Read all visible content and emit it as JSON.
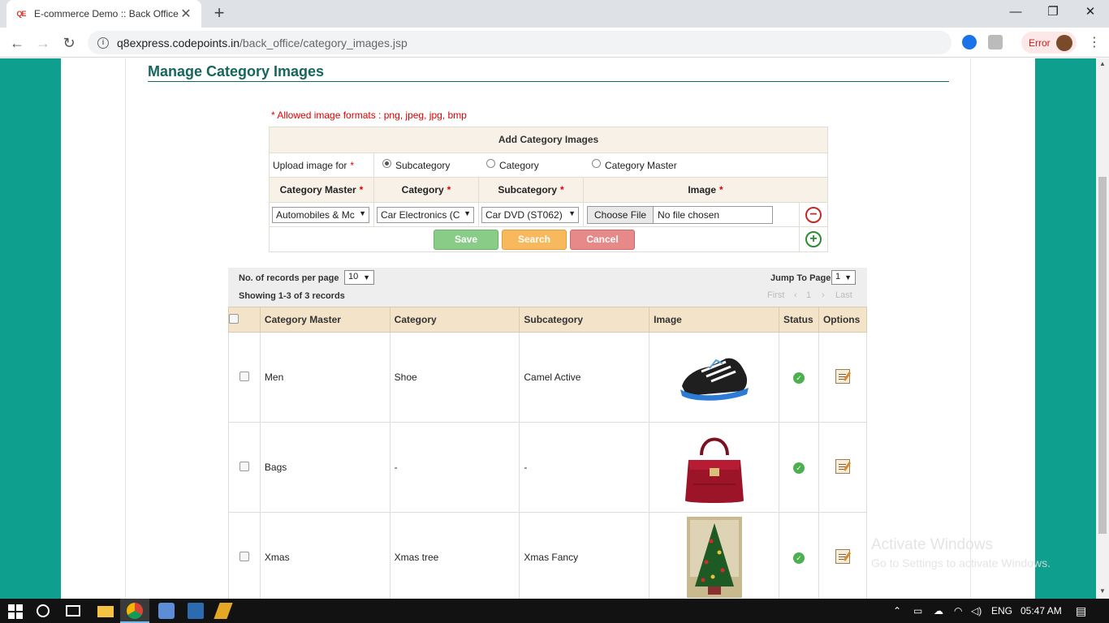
{
  "browser": {
    "tab_favicon": "QE",
    "tab_title": "E-commerce Demo :: Back Office",
    "tab_close": "✕",
    "new_tab": "+",
    "url_host": "q8express.codepoints.in",
    "url_path": "/back_office/category_images.jsp",
    "error_label": "Error",
    "window_minimize": "—",
    "window_restore": "❐",
    "window_close": "✕"
  },
  "page": {
    "title": "Manage Category Images",
    "allowed_formats_note": "* Allowed image formats : png, jpeg, jpg, bmp"
  },
  "add_form": {
    "heading": "Add Category Images",
    "upload_for_label": "Upload image for",
    "required_mark": "*",
    "radio_options": [
      {
        "label": "Subcategory",
        "checked": true
      },
      {
        "label": "Category",
        "checked": false
      },
      {
        "label": "Category Master",
        "checked": false
      }
    ],
    "columns": [
      "Category Master",
      "Category",
      "Subcategory",
      "Image"
    ],
    "category_master_value": "Automobiles & Mc",
    "category_value": "Car Electronics (C",
    "subcategory_value": "Car DVD (ST062)",
    "file_button": "Choose File",
    "file_status": "No file chosen",
    "buttons": {
      "save": "Save",
      "search": "Search",
      "cancel": "Cancel"
    }
  },
  "listing": {
    "records_per_page_label": "No. of records per page",
    "records_per_page_value": "10",
    "showing_text": "Showing 1-3 of 3 records",
    "jump_to_page_label": "Jump To Page",
    "jump_to_page_value": "1",
    "pager": {
      "first": "First",
      "prev": "‹",
      "current": "1",
      "next": "›",
      "last": "Last"
    },
    "columns": [
      "Category Master",
      "Category",
      "Subcategory",
      "Image",
      "Status",
      "Options"
    ],
    "rows": [
      {
        "category_master": "Men",
        "category": "Shoe",
        "subcategory": "Camel Active",
        "image": "shoe-image",
        "status": "active"
      },
      {
        "category_master": "Bags",
        "category": "-",
        "subcategory": "-",
        "image": "handbag-image",
        "status": "active"
      },
      {
        "category_master": "Xmas",
        "category": "Xmas tree",
        "subcategory": "Xmas Fancy",
        "image": "christmas-tree-image",
        "status": "active"
      }
    ]
  },
  "watermark": {
    "title": "Activate Windows",
    "subtitle": "Go to Settings to activate Windows."
  },
  "taskbar": {
    "language": "ENG",
    "time": "05:47 AM"
  },
  "colors": {
    "page_background": "#0e9f8f",
    "title_color": "#17665e",
    "header_tan": "#f3e3c8",
    "note_red": "#e00000"
  }
}
